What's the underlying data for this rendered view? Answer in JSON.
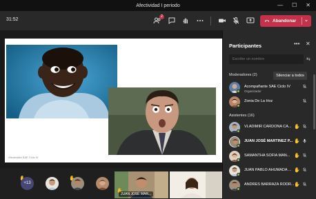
{
  "window": {
    "title": "Afectividad I periodo",
    "controls": {
      "minimize": "—",
      "maximize": "☐",
      "close": "✕"
    }
  },
  "toolbar": {
    "timer": "31:52",
    "participants_badge": "2",
    "leave_label": "Abandonar",
    "accent": "#c4314b"
  },
  "stage": {
    "watermark": "Afectividad SAE Ciclo IV"
  },
  "filmstrip": {
    "more_count": "+13",
    "tile_label": "JUAN JOSÉ MAR...",
    "colors": {
      "more_bg": "#464775"
    }
  },
  "panel": {
    "title": "Participantes",
    "search_placeholder": "Escribe un nombre",
    "moderators_label": "Moderadores (2)",
    "mute_all_label": "Silenciar a todos",
    "attendees_label": "Asistentes (16)",
    "moderators": [
      {
        "name": "Acompañante SAE Ciclo IV",
        "role": "Organizador",
        "hand": false,
        "mic": "muted"
      },
      {
        "name": "Zonia De La Hoz",
        "role": "",
        "hand": false,
        "mic": "muted"
      }
    ],
    "attendees": [
      {
        "name": "VLADIMIR CARDONA CA...",
        "hand": true,
        "mic": "muted"
      },
      {
        "name": "JUAN JOSÉ MARTINEZ P...",
        "hand": true,
        "mic": "on"
      },
      {
        "name": "SAMANTHA SOFIA MAN...",
        "hand": true,
        "mic": "muted"
      },
      {
        "name": "JUAN PABLO AHUMADA ...",
        "hand": true,
        "mic": "muted"
      },
      {
        "name": "ANDRES BARRAZA RODR...",
        "hand": true,
        "mic": "muted"
      }
    ]
  }
}
